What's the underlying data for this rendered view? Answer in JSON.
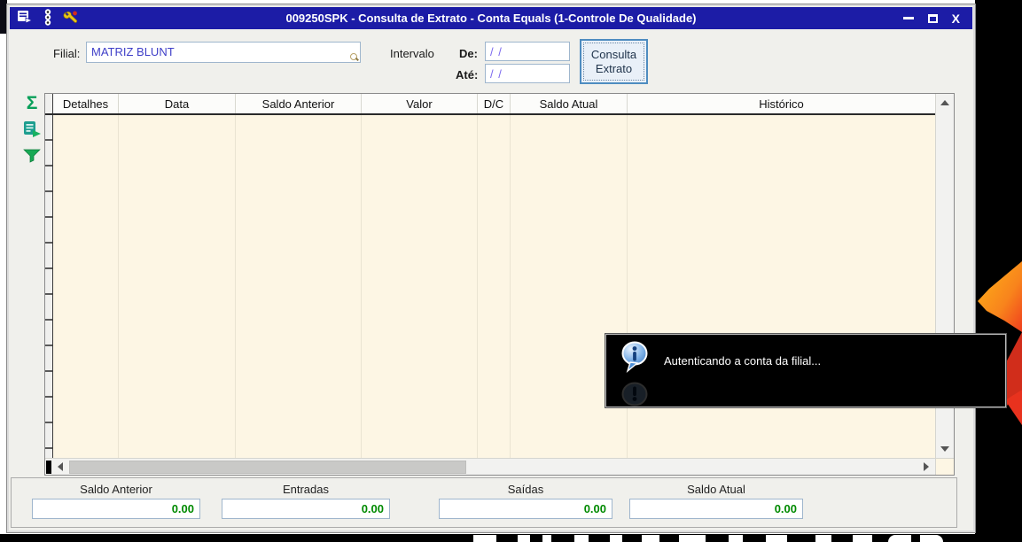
{
  "window": {
    "title": "009250SPK - Consulta de Extrato - Conta Equals (1-Controle De Qualidade)"
  },
  "icons": {
    "close_glyph": "x",
    "sigma_glyph": "Σ"
  },
  "form": {
    "filial_label": "Filial:",
    "filial_value": "MATRIZ BLUNT",
    "intervalo_label": "Intervalo",
    "de_label": "De:",
    "de_value": "/ /",
    "ate_label": "Até:",
    "ate_value": "/ /",
    "consulta_button_line1": "Consulta",
    "consulta_button_line2": "Extrato"
  },
  "grid": {
    "columns": [
      "Detalhes",
      "Data",
      "Saldo Anterior",
      "Valor",
      "D/C",
      "Saldo Atual",
      "Histórico"
    ],
    "rows": []
  },
  "popup": {
    "message": "Autenticando a conta da filial..."
  },
  "summary": {
    "fields": [
      {
        "label": "Saldo Anterior",
        "value": "0.00"
      },
      {
        "label": "Entradas",
        "value": "0.00"
      },
      {
        "label": "Saídas",
        "value": "0.00"
      },
      {
        "label": "Saldo Atual",
        "value": "0.00"
      }
    ]
  },
  "colors": {
    "titlebar": "#1C1CA6",
    "value_green": "#008A00",
    "grid_body": "#FDF6E4",
    "flame_orange": "#FFA019",
    "flame_red": "#E8321E"
  }
}
